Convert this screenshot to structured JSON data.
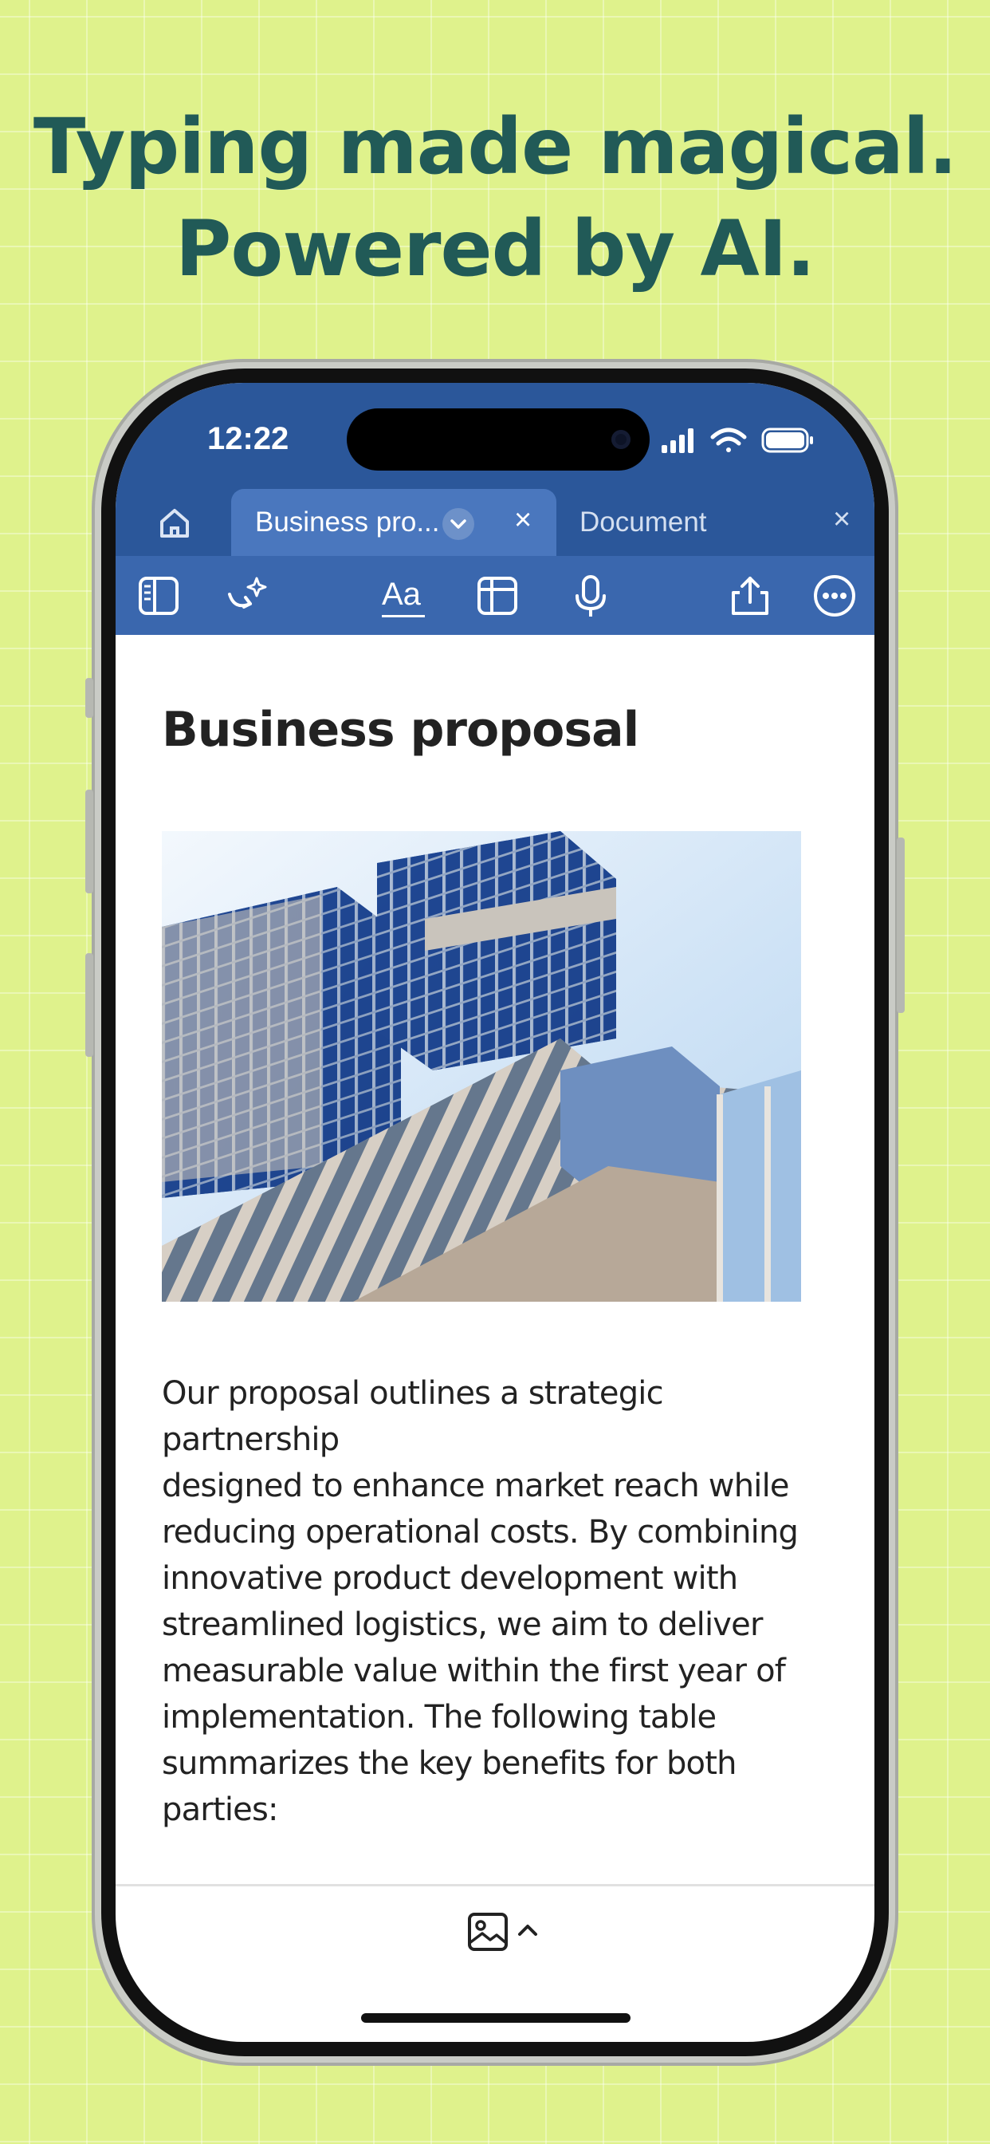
{
  "headline": {
    "line1": "Typing made magical.",
    "line2": "Powered by AI."
  },
  "colors": {
    "background": "#dff28c",
    "headline": "#215a57",
    "app_bar": "#2b579a",
    "toolbar": "#3a67ae"
  },
  "status_bar": {
    "time": "12:22",
    "icons": [
      "signal-icon",
      "wifi-icon",
      "battery-icon"
    ]
  },
  "tabs": {
    "home_icon": "home-icon",
    "active_label": "Business pro...",
    "inactive_label": "Document",
    "close_glyph": "×"
  },
  "toolbar": {
    "icons": [
      "sidebar-icon",
      "copilot-icon",
      "text-format-icon",
      "table-icon",
      "microphone-icon",
      "share-icon",
      "more-icon"
    ],
    "format_label": "Aa"
  },
  "document": {
    "title": "Business proposal",
    "image_icon": "building-photo",
    "body_lines": [
      "Our proposal outlines a strategic partnership",
      "designed to enhance market reach while",
      "reducing operational costs. By combining",
      "innovative product development with",
      "streamlined logistics, we aim to deliver",
      "measurable value within the first year of",
      "implementation. The following table",
      "summarizes the key benefits for both parties:"
    ]
  },
  "bottom_bar": {
    "insert_icon": "image-icon",
    "expand_icon": "chevron-up-icon"
  }
}
